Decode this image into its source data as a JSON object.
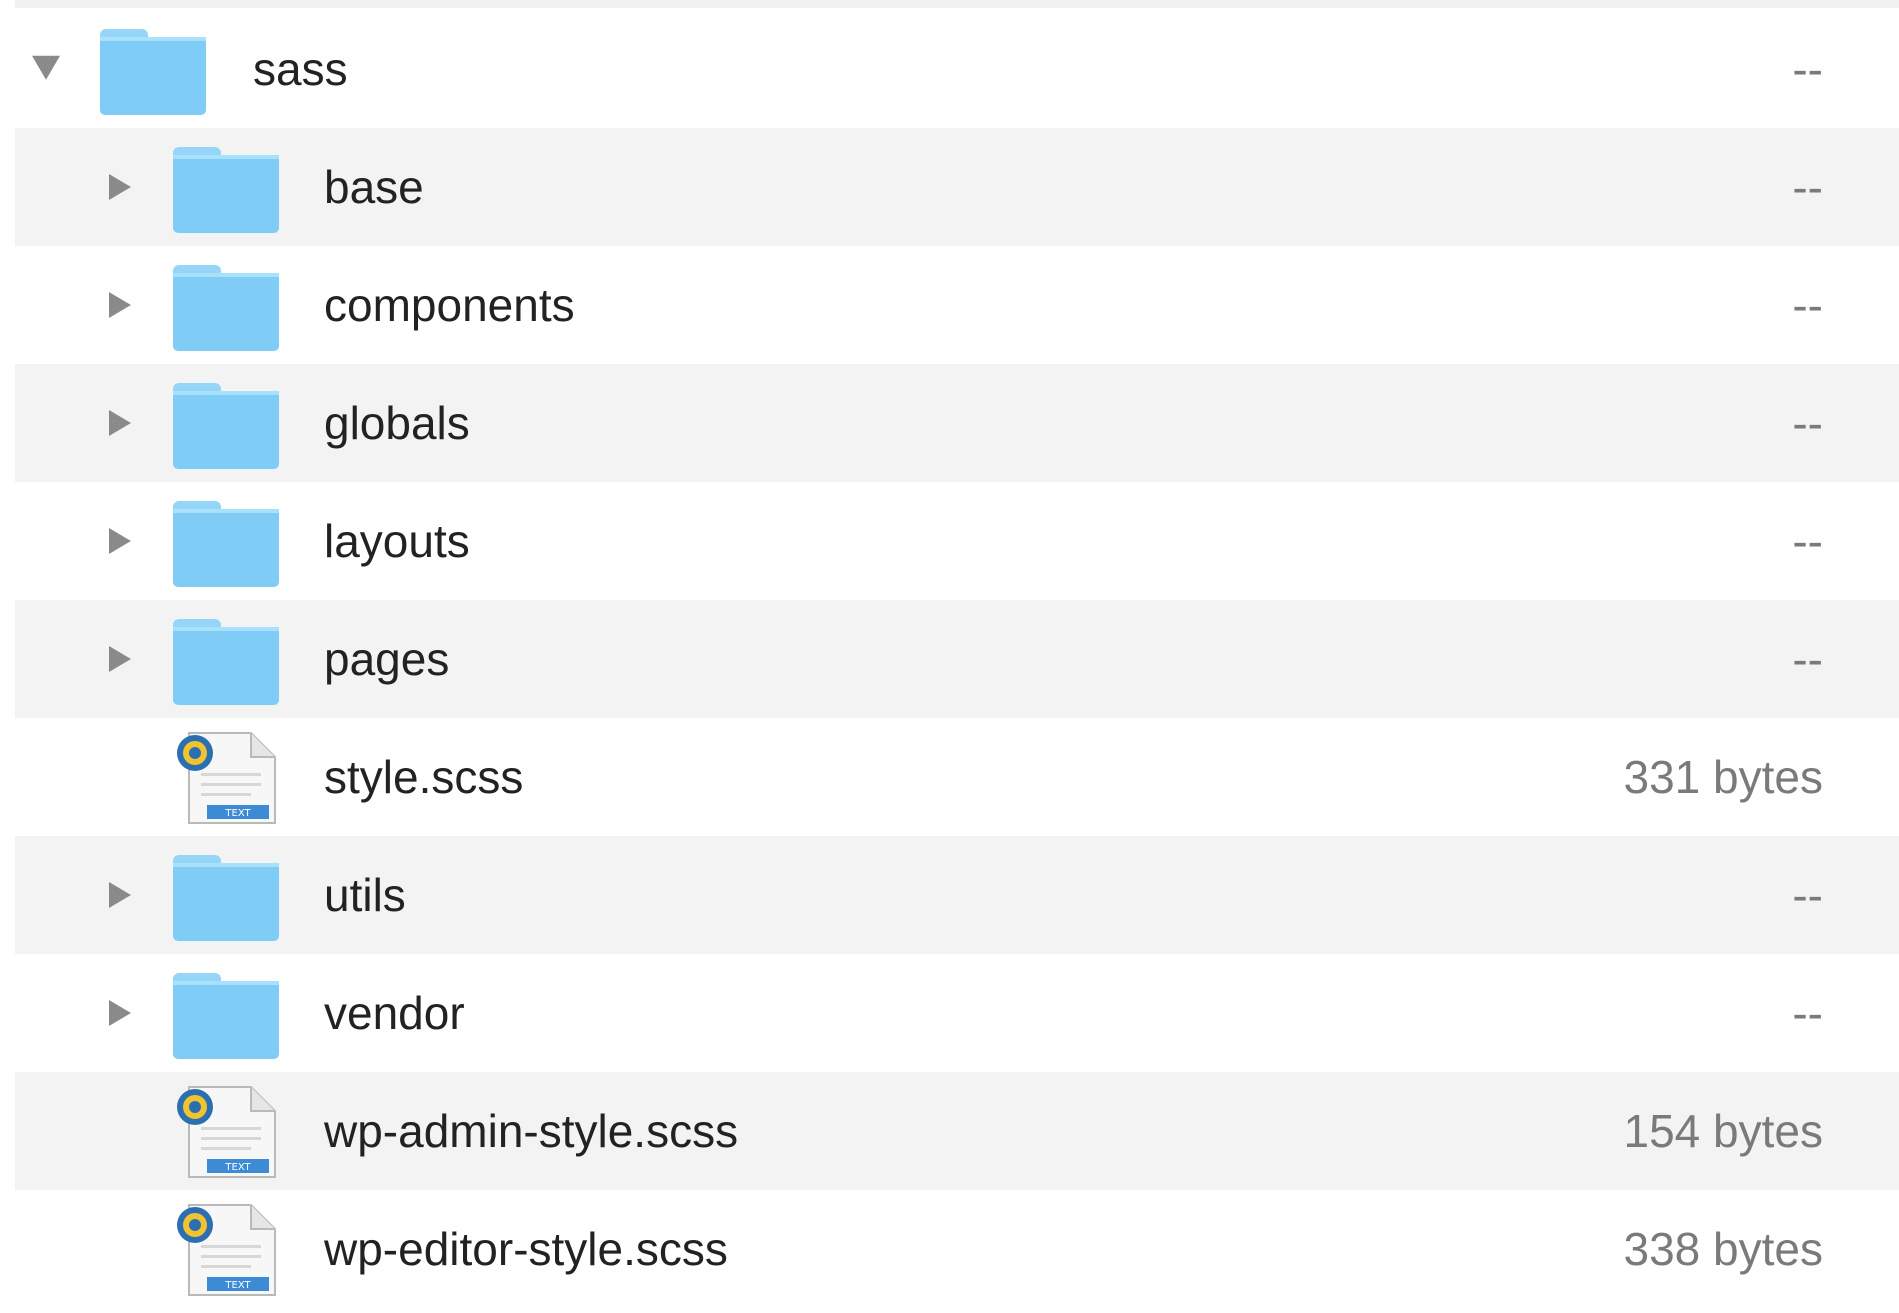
{
  "colors": {
    "folder": "#7fcdf6",
    "folder_tab": "#95d6f8",
    "row_alt": "#f3f3f3",
    "text": "#222222",
    "size_text": "#7a7a7a",
    "disclosure": "#8a8a8a"
  },
  "items": [
    {
      "name": "sass",
      "size": "--",
      "kind": "folder",
      "expanded": true,
      "level": 0
    },
    {
      "name": "base",
      "size": "--",
      "kind": "folder",
      "expanded": false,
      "level": 1
    },
    {
      "name": "components",
      "size": "--",
      "kind": "folder",
      "expanded": false,
      "level": 1
    },
    {
      "name": "globals",
      "size": "--",
      "kind": "folder",
      "expanded": false,
      "level": 1
    },
    {
      "name": "layouts",
      "size": "--",
      "kind": "folder",
      "expanded": false,
      "level": 1
    },
    {
      "name": "pages",
      "size": "--",
      "kind": "folder",
      "expanded": false,
      "level": 1
    },
    {
      "name": "style.scss",
      "size": "331 bytes",
      "kind": "file",
      "level": 1,
      "icon_label": "TEXT"
    },
    {
      "name": "utils",
      "size": "--",
      "kind": "folder",
      "expanded": false,
      "level": 1
    },
    {
      "name": "vendor",
      "size": "--",
      "kind": "folder",
      "expanded": false,
      "level": 1
    },
    {
      "name": "wp-admin-style.scss",
      "size": "154 bytes",
      "kind": "file",
      "level": 1,
      "icon_label": "TEXT"
    },
    {
      "name": "wp-editor-style.scss",
      "size": "338 bytes",
      "kind": "file",
      "level": 1,
      "icon_label": "TEXT"
    }
  ]
}
